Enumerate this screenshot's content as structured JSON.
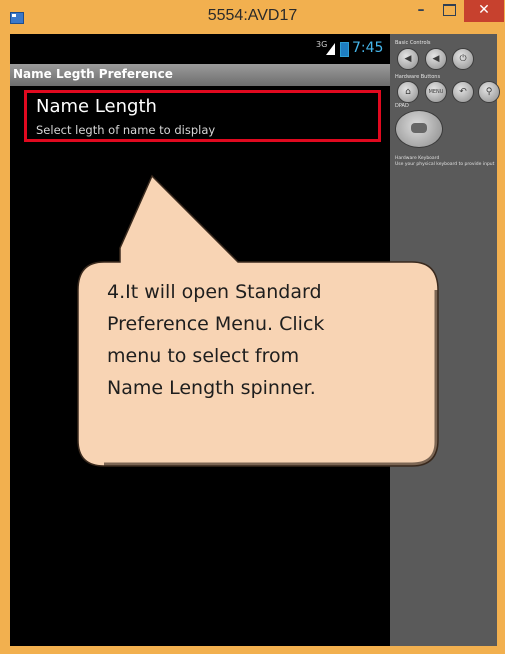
{
  "window": {
    "title": "5554:AVD17",
    "minimize_glyph": "–",
    "close_glyph": "✕"
  },
  "status_bar": {
    "network": "3G",
    "time": "7:45"
  },
  "app_bar": {
    "title": "Name Legth Preference"
  },
  "preference": {
    "title": "Name Length",
    "summary": "Select legth of name to display"
  },
  "controls": {
    "basic_controls_label": "Basic Controls",
    "hardware_buttons_label": "Hardware Buttons",
    "dpad_label": "DPAD",
    "keyboard_label": "Hardware Keyboard",
    "keyboard_hint": "Use your physical keyboard to provide input",
    "menu_label": "MENU"
  },
  "callout": {
    "lines": [
      "4.It will open Standard",
      "Preference Menu. Click",
      "menu to select from",
      "Name Length spinner."
    ]
  },
  "colors": {
    "frame": "#f2b04f",
    "close_button": "#c7412e",
    "highlight_border": "#e0091f",
    "callout_fill": "#f8d4b4",
    "clock": "#45b6ea"
  }
}
